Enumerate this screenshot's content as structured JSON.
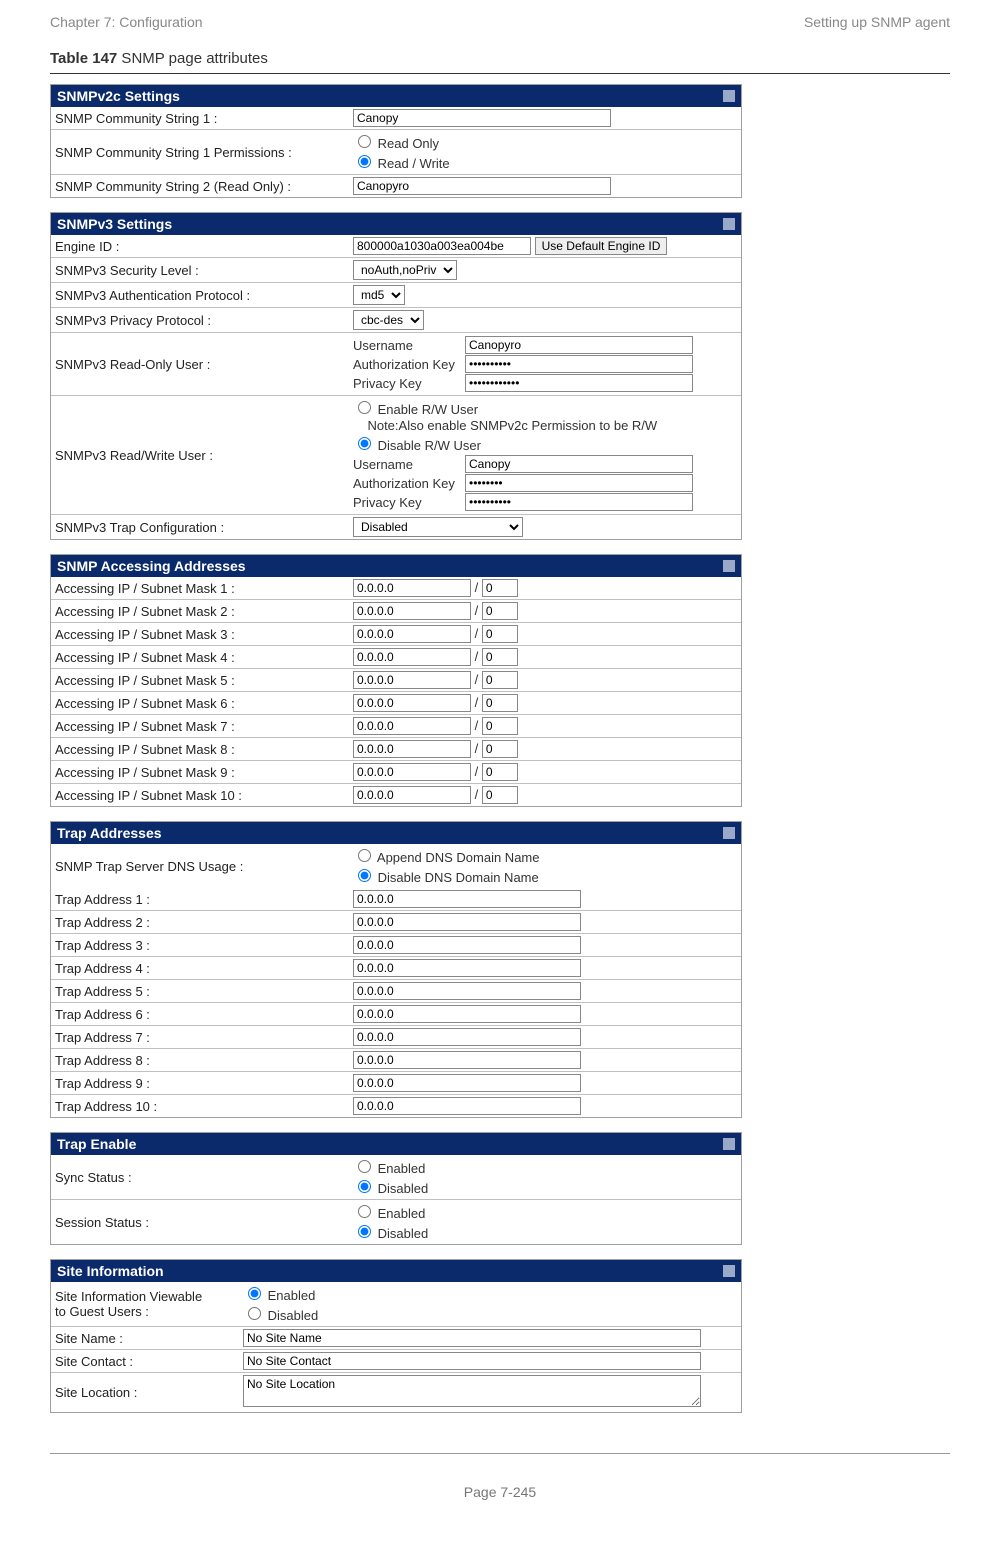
{
  "header": {
    "left": "Chapter 7:  Configuration",
    "right": "Setting up SNMP agent"
  },
  "caption": {
    "bold": "Table 147",
    "rest": " SNMP page attributes"
  },
  "v2c": {
    "title": "SNMPv2c Settings",
    "r1": {
      "label": "SNMP Community String 1 :",
      "value": "Canopy"
    },
    "r2": {
      "label": "SNMP Community String 1 Permissions :",
      "opt1": "Read Only",
      "opt2": "Read / Write"
    },
    "r3": {
      "label": "SNMP Community String 2 (Read Only) :",
      "value": "Canopyro"
    }
  },
  "v3": {
    "title": "SNMPv3 Settings",
    "engine": {
      "label": "Engine ID :",
      "value": "800000a1030a003ea004be",
      "btn": "Use Default Engine ID"
    },
    "sec": {
      "label": "SNMPv3 Security Level :",
      "value": "noAuth,noPriv"
    },
    "auth": {
      "label": "SNMPv3 Authentication Protocol :",
      "value": "md5"
    },
    "priv": {
      "label": "SNMPv3 Privacy Protocol :",
      "value": "cbc-des"
    },
    "ro": {
      "label": "SNMPv3 Read-Only User :",
      "userlabel": "Username",
      "user": "Canopyro",
      "aklabel": "Authorization Key",
      "ak": "••••••••••",
      "pklabel": "Privacy Key",
      "pk": "••••••••••••"
    },
    "rw": {
      "label": "SNMPv3 Read/Write User :",
      "en": "Enable R/W User",
      "note": "Note:Also enable SNMPv2c Permission to be R/W",
      "dis": "Disable R/W User",
      "userlabel": "Username",
      "user": "Canopy",
      "aklabel": "Authorization Key",
      "ak": "••••••••",
      "pklabel": "Privacy Key",
      "pk": "••••••••••"
    },
    "trap": {
      "label": "SNMPv3 Trap Configuration :",
      "value": "Disabled"
    }
  },
  "access": {
    "title": "SNMP Accessing Addresses",
    "rows": [
      {
        "label": "Accessing IP / Subnet Mask 1 :",
        "ip": "0.0.0.0",
        "mask": "0"
      },
      {
        "label": "Accessing IP / Subnet Mask 2 :",
        "ip": "0.0.0.0",
        "mask": "0"
      },
      {
        "label": "Accessing IP / Subnet Mask 3 :",
        "ip": "0.0.0.0",
        "mask": "0"
      },
      {
        "label": "Accessing IP / Subnet Mask 4 :",
        "ip": "0.0.0.0",
        "mask": "0"
      },
      {
        "label": "Accessing IP / Subnet Mask 5 :",
        "ip": "0.0.0.0",
        "mask": "0"
      },
      {
        "label": "Accessing IP / Subnet Mask 6 :",
        "ip": "0.0.0.0",
        "mask": "0"
      },
      {
        "label": "Accessing IP / Subnet Mask 7 :",
        "ip": "0.0.0.0",
        "mask": "0"
      },
      {
        "label": "Accessing IP / Subnet Mask 8 :",
        "ip": "0.0.0.0",
        "mask": "0"
      },
      {
        "label": "Accessing IP / Subnet Mask 9 :",
        "ip": "0.0.0.0",
        "mask": "0"
      },
      {
        "label": "Accessing IP / Subnet Mask 10 :",
        "ip": "0.0.0.0",
        "mask": "0"
      }
    ]
  },
  "trapaddr": {
    "title": "Trap Addresses",
    "dns": {
      "label": "SNMP Trap Server DNS Usage :",
      "opt1": "Append DNS Domain Name",
      "opt2": "Disable DNS Domain Name"
    },
    "rows": [
      {
        "label": "Trap Address 1 :",
        "ip": "0.0.0.0"
      },
      {
        "label": "Trap Address 2 :",
        "ip": "0.0.0.0"
      },
      {
        "label": "Trap Address 3 :",
        "ip": "0.0.0.0"
      },
      {
        "label": "Trap Address 4 :",
        "ip": "0.0.0.0"
      },
      {
        "label": "Trap Address 5 :",
        "ip": "0.0.0.0"
      },
      {
        "label": "Trap Address 6 :",
        "ip": "0.0.0.0"
      },
      {
        "label": "Trap Address 7 :",
        "ip": "0.0.0.0"
      },
      {
        "label": "Trap Address 8 :",
        "ip": "0.0.0.0"
      },
      {
        "label": "Trap Address 9 :",
        "ip": "0.0.0.0"
      },
      {
        "label": "Trap Address 10 :",
        "ip": "0.0.0.0"
      }
    ]
  },
  "trapenable": {
    "title": "Trap Enable",
    "sync": {
      "label": "Sync Status :",
      "en": "Enabled",
      "dis": "Disabled"
    },
    "session": {
      "label": "Session Status :",
      "en": "Enabled",
      "dis": "Disabled"
    }
  },
  "site": {
    "title": "Site Information",
    "guest": {
      "label1": "Site Information Viewable",
      "label2": "to Guest Users :",
      "en": "Enabled",
      "dis": "Disabled"
    },
    "name": {
      "label": "Site Name :",
      "value": "No Site Name"
    },
    "contact": {
      "label": "Site Contact :",
      "value": "No Site Contact"
    },
    "loc": {
      "label": "Site Location :",
      "value": "No Site Location"
    }
  },
  "footer": {
    "page": "Page 7-245"
  }
}
